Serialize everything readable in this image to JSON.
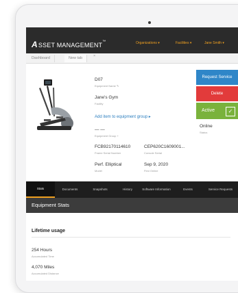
{
  "header": {
    "logo_letter": "A",
    "logo_text": "SSET MANAGEMENT",
    "logo_tm": "™",
    "nav": [
      "Organizations ▾",
      "Facilities ▾",
      "Jane Smith ▾"
    ]
  },
  "browser_tabs": [
    {
      "label": "Dashboard"
    },
    {
      "label": "New tab"
    }
  ],
  "tab_close": "×",
  "equipment": {
    "name_value": "D07",
    "name_label": "Equipment Name",
    "facility_value": "Jane's Gym",
    "facility_label": "Facility",
    "add_group_link": "Add item to equipment group ▸",
    "group_value": "— —",
    "group_label": "Equipment Group",
    "frame_serial_value": "FCB92170114610",
    "frame_serial_label": "Frame Serial Number",
    "console_serial_value": "CEP620C1609001...",
    "console_serial_label": "Console Serial",
    "model_value": "Perf. Elliptical",
    "model_label": "Model",
    "first_online_value": "Sep 9, 2020",
    "first_online_label": "First Online",
    "status_value": "Online",
    "status_label": "Status"
  },
  "actions": {
    "request_service": "Request Service",
    "delete": "Delete",
    "active": "Active",
    "active_check": "✓"
  },
  "detail_tabs": [
    {
      "label": "Stats"
    },
    {
      "label": "Documents"
    },
    {
      "label": "Snapshots"
    },
    {
      "label": "History"
    },
    {
      "label": "Software Information"
    },
    {
      "label": "Events"
    },
    {
      "label": "Service Requests"
    }
  ],
  "stats": {
    "header": "Equipment Stats",
    "section_title": "Lifetime usage",
    "hours_value": "254 Hours",
    "hours_label": "Accumulated Time",
    "miles_value": "4,070 Miles",
    "miles_label": "Accumulated Distance"
  },
  "colors": {
    "accent": "#f0a020",
    "request": "#2f86c8",
    "delete": "#e23b3b",
    "active": "#7ab23c"
  },
  "icons": {
    "edit": "edit-icon",
    "add": "plus-icon",
    "check": "check-icon"
  }
}
